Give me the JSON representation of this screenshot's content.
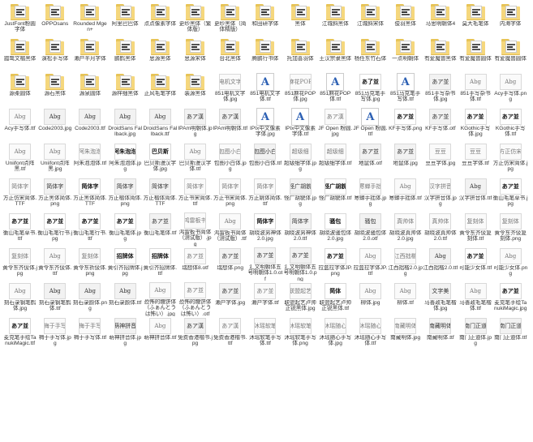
{
  "files": [
    {
      "name": "JustFont粉圆字体",
      "kind": "folder"
    },
    {
      "name": "OPPOsans",
      "kind": "folder"
    },
    {
      "name": "Rounded Mgen+",
      "kind": "folder"
    },
    {
      "name": "阿里巴巴体",
      "kind": "folder"
    },
    {
      "name": "点点像素字体",
      "kind": "folder"
    },
    {
      "name": "更纱黑体（繁体版）",
      "kind": "folder"
    },
    {
      "name": "更纱黑体（简体精版）",
      "kind": "folder"
    },
    {
      "name": "和田研字体",
      "kind": "folder"
    },
    {
      "name": "黑体",
      "kind": "folder"
    },
    {
      "name": "江城斜黑体",
      "kind": "folder"
    },
    {
      "name": "江城斜宋体",
      "kind": "folder"
    },
    {
      "name": "俊羽黑体",
      "kind": "folder"
    },
    {
      "name": "马思明朝体4",
      "kind": "folder"
    },
    {
      "name": "莫大毛笔体",
      "kind": "folder"
    },
    {
      "name": "内海字体",
      "kind": "folder"
    },
    {
      "name": "霞鹜文楷黑体",
      "kind": "folder"
    },
    {
      "name": "演松手写体",
      "kind": "folder"
    },
    {
      "name": "濑户半月字体",
      "kind": "folder"
    },
    {
      "name": "鹏鹤黑体",
      "kind": "folder"
    },
    {
      "name": "思源黑体",
      "kind": "folder"
    },
    {
      "name": "思源宋体",
      "kind": "folder"
    },
    {
      "name": "台北黑体",
      "kind": "folder"
    },
    {
      "name": "腾鹏行书体",
      "kind": "folder"
    },
    {
      "name": "托加喜羽体",
      "kind": "folder"
    },
    {
      "name": "王汉宗隶黑体",
      "kind": "folder"
    },
    {
      "name": "杨任东竹石体",
      "kind": "folder"
    },
    {
      "name": "一点明朝体",
      "kind": "folder"
    },
    {
      "name": "有爱魔兽黑体",
      "kind": "folder"
    },
    {
      "name": "有爱魔兽圆体",
      "kind": "folder"
    },
    {
      "name": "有爱魔兽圆体",
      "kind": "folder"
    },
    {
      "name": "源柔圆体",
      "kind": "folder"
    },
    {
      "name": "源石黑体",
      "kind": "folder"
    },
    {
      "name": "源泉圆体",
      "kind": "folder"
    },
    {
      "name": "源样细黑体",
      "kind": "folder"
    },
    {
      "name": "正风毛笔字体",
      "kind": "folder"
    },
    {
      "name": "装源黑体",
      "kind": "folder"
    },
    {
      "name": "851电机文字体.jpg",
      "kind": "image",
      "sample": "电机文字",
      "style": "light"
    },
    {
      "name": "851电机文字体.ttf",
      "kind": "font"
    },
    {
      "name": "851麻花POP体.jpg",
      "kind": "image",
      "sample": "麻花POP",
      "style": "light"
    },
    {
      "name": "851麻花POP体.ttf",
      "kind": "font"
    },
    {
      "name": "851马克笔手写体.jpg",
      "kind": "image",
      "sample": "あ了並",
      "style": "dark"
    },
    {
      "name": "851马克笔手写体.ttf",
      "kind": "font"
    },
    {
      "name": "851手写杂书体.jpg",
      "kind": "image",
      "sample": "あア並",
      "style": "normal"
    },
    {
      "name": "851手写杂书体.ttf",
      "kind": "image",
      "sample": "Abg",
      "style": "light"
    },
    {
      "name": "Acy手写体.png",
      "kind": "image",
      "sample": "Abg",
      "style": "light"
    },
    {
      "name": "Acy手写体.ttf",
      "kind": "image",
      "sample": "Abg",
      "style": "light"
    },
    {
      "name": "Code2003.jpg",
      "kind": "image",
      "sample": "Abg",
      "style": "normal"
    },
    {
      "name": "Code2003.ttf",
      "kind": "image",
      "sample": "Abg",
      "style": "normal"
    },
    {
      "name": "DroidSans Fallback.jpg",
      "kind": "image",
      "sample": "Abg",
      "style": "normal"
    },
    {
      "name": "DroidSans Fallback.ttf",
      "kind": "image",
      "sample": "Abg",
      "style": "normal"
    },
    {
      "name": "IPAm明朝体.jpg",
      "kind": "image",
      "sample": "あア漢",
      "style": "normal"
    },
    {
      "name": "IPAm明朝体.ttf",
      "kind": "image",
      "sample": "あア漢",
      "style": "normal"
    },
    {
      "name": "IPIx中文像素字体.jpg",
      "kind": "font"
    },
    {
      "name": "IPIx中文像素字体.ttf",
      "kind": "font"
    },
    {
      "name": "JF Open 粉圆.jpg",
      "kind": "image",
      "sample": "あア漢",
      "style": "light"
    },
    {
      "name": "JF Open 粉圆.ttf",
      "kind": "font"
    },
    {
      "name": "KF手写体.png",
      "kind": "image",
      "sample": "あア並",
      "style": "dark"
    },
    {
      "name": "KF手写体.otf",
      "kind": "image",
      "sample": "あア並",
      "style": "normal"
    },
    {
      "name": "KGothic手写体.jpg",
      "kind": "image",
      "sample": "あア並",
      "style": "dark"
    },
    {
      "name": "KGothic手写体.ttf",
      "kind": "image",
      "sample": "あア並",
      "style": "dark"
    },
    {
      "name": "Uniifont点阵黑.ttf",
      "kind": "image",
      "sample": "Abg",
      "style": "light"
    },
    {
      "name": "Uniifont点阵黑.jpg",
      "kind": "image",
      "sample": "Abg",
      "style": "light"
    },
    {
      "name": "阿朱泡泡体.ttf",
      "kind": "image",
      "sample": "阿朱泡泡",
      "style": "light"
    },
    {
      "name": "阿朱泡泡体.jpg",
      "kind": "image",
      "sample": "阿朱泡泡",
      "style": "dark"
    },
    {
      "name": "巴贝斯漫汉字体.jpg",
      "kind": "image",
      "sample": "巴贝斯",
      "style": "dark"
    },
    {
      "name": "巴贝斯漫汉字体.ttf",
      "kind": "image",
      "sample": "Abg",
      "style": "light"
    },
    {
      "name": "包图小白体.jpg",
      "kind": "image",
      "sample": "包图小白",
      "style": "light"
    },
    {
      "name": "包图小白体.ttf",
      "kind": "image",
      "sample": "包图小白",
      "style": "normal"
    },
    {
      "name": "超级细字体.jpg",
      "kind": "image",
      "sample": "超级细",
      "style": "light"
    },
    {
      "name": "超级细字体.ttf",
      "kind": "image",
      "sample": "超级细",
      "style": "light"
    },
    {
      "name": "地鼠体.otf",
      "kind": "image",
      "sample": "あア並",
      "style": "normal"
    },
    {
      "name": "地鼠体.jpg",
      "kind": "image",
      "sample": "あア並",
      "style": "normal"
    },
    {
      "name": "豆豆字体.jpg",
      "kind": "image",
      "sample": "豆豆",
      "style": "light"
    },
    {
      "name": "豆豆字体.ttf",
      "kind": "image",
      "sample": "豆豆",
      "style": "light"
    },
    {
      "name": "方正仿宋简体.jpg",
      "kind": "image",
      "sample": "方正仿宋",
      "style": "light"
    },
    {
      "name": "方正仿宋简体.TTF",
      "kind": "image",
      "sample": "简体字",
      "style": "light"
    },
    {
      "name": "方正黑体简体.png",
      "kind": "image",
      "sample": "简体字",
      "style": "normal"
    },
    {
      "name": "方正黑体简体.TTF",
      "kind": "image",
      "sample": "简体字",
      "style": "dark"
    },
    {
      "name": "方正楷体简体.png",
      "kind": "image",
      "sample": "简体字",
      "style": "normal"
    },
    {
      "name": "方正楷体简体.TTF",
      "kind": "image",
      "sample": "简体字",
      "style": "normal"
    },
    {
      "name": "方正书宋简体.ttf",
      "kind": "image",
      "sample": "简体字",
      "style": "light"
    },
    {
      "name": "方正书宋简体.png",
      "kind": "image",
      "sample": "简体字",
      "style": "light"
    },
    {
      "name": "方正姚体简体.ttf",
      "kind": "image",
      "sample": "简体字",
      "style": "light"
    },
    {
      "name": "怪广胡貌体.jpg",
      "kind": "image",
      "sample": "怪广胡貌",
      "style": "normal"
    },
    {
      "name": "怪广胡貌体.ttf",
      "kind": "image",
      "sample": "怪广胡貌",
      "style": "dark"
    },
    {
      "name": "寒蝉手拙体.jpg",
      "kind": "image",
      "sample": "寒蝉手拙",
      "style": "light"
    },
    {
      "name": "寒蝉手拙体.ttf",
      "kind": "image",
      "sample": "Abg",
      "style": "light"
    },
    {
      "name": "汉字拼音体.jpg",
      "kind": "image",
      "sample": "汉字拼音",
      "style": "light"
    },
    {
      "name": "汉字拼音体.ttf",
      "kind": "image",
      "sample": "Abg",
      "style": "normal"
    },
    {
      "name": "衡山毛笔草书.jpg",
      "kind": "image",
      "sample": "あア並",
      "style": "dark"
    },
    {
      "name": "衡山毛笔草书.ttf",
      "kind": "image",
      "sample": "あア並",
      "style": "dark"
    },
    {
      "name": "衡山毛笔行书.jpg",
      "kind": "image",
      "sample": "あア並",
      "style": "dark"
    },
    {
      "name": "衡山毛笔行书.ttf",
      "kind": "image",
      "sample": "あア並",
      "style": "dark"
    },
    {
      "name": "衡山毛笔体.jpg",
      "kind": "image",
      "sample": "あア並",
      "style": "dark"
    },
    {
      "name": "衡山毛笔体.ttf",
      "kind": "image",
      "sample": "あア並",
      "style": "normal"
    },
    {
      "name": "鸿雷板书简体（测试版）.jpg",
      "kind": "image",
      "sample": "鸿雷板书",
      "style": "light"
    },
    {
      "name": "鸿雷板书简体（测试版）.ttf",
      "kind": "image",
      "sample": "Abg",
      "style": "light"
    },
    {
      "name": "胡晓波男神体2.0.jpg",
      "kind": "image",
      "sample": "简体字",
      "style": "dark"
    },
    {
      "name": "胡晓波男神体2.0.ttf",
      "kind": "image",
      "sample": "简体字",
      "style": "normal"
    },
    {
      "name": "胡晓波骚包体2.0.jpg",
      "kind": "image",
      "sample": "骚包",
      "style": "dark"
    },
    {
      "name": "胡晓波骚包体2.0.otf",
      "kind": "image",
      "sample": "骚包",
      "style": "normal"
    },
    {
      "name": "胡晓波真帅体2.0.jpg",
      "kind": "image",
      "sample": "真帅体",
      "style": "light"
    },
    {
      "name": "胡晓波真帅体2.0.ttf",
      "kind": "image",
      "sample": "真帅体",
      "style": "light"
    },
    {
      "name": "黄令东齐伋复刻体.ttf",
      "kind": "image",
      "sample": "复刻体",
      "style": "light"
    },
    {
      "name": "黄令东齐伋复刻体.png",
      "kind": "image",
      "sample": "复刻体",
      "style": "light"
    },
    {
      "name": "黄令东齐伋体.jpg",
      "kind": "image",
      "sample": "复刻体",
      "style": "light"
    },
    {
      "name": "黄令东齐伋体.ttf",
      "kind": "image",
      "sample": "Abg",
      "style": "light"
    },
    {
      "name": "黄令东祈伋体.png",
      "kind": "image",
      "sample": "复刻体",
      "style": "light"
    },
    {
      "name": "黄引齐招牌体.jpg",
      "kind": "image",
      "sample": "招牌体",
      "style": "dark"
    },
    {
      "name": "黄引齐招牌体.ttf",
      "kind": "image",
      "sample": "招牌体",
      "style": "dark"
    },
    {
      "name": "瑞想体8.otf",
      "kind": "image",
      "sample": "あア並",
      "style": "light"
    },
    {
      "name": "瑞想体.png",
      "kind": "image",
      "sample": "あア並",
      "style": "normal"
    },
    {
      "name": "汇文明朝体五号明朝体1.0.otf",
      "kind": "image",
      "sample": "あア並",
      "style": "normal"
    },
    {
      "name": "汇文明朝体五号明朝体1.0.png",
      "kind": "image",
      "sample": "あア並",
      "style": "normal"
    },
    {
      "name": "拉盒拉字体JP.png",
      "kind": "image",
      "sample": "あア並",
      "style": "dark"
    },
    {
      "name": "拉盒拉字体JP.ttf",
      "kind": "image",
      "sample": "Abg",
      "style": "light"
    },
    {
      "name": "江西拙楷2.0.jpg",
      "kind": "image",
      "sample": "江西拙楷",
      "style": "light"
    },
    {
      "name": "江西拙楷2.0.ttf",
      "kind": "image",
      "sample": "Abg",
      "style": "normal"
    },
    {
      "name": "可能少女体.ttf",
      "kind": "image",
      "sample": "あア並",
      "style": "dark"
    },
    {
      "name": "可能少女体.png",
      "kind": "image",
      "sample": "Abg",
      "style": "light"
    },
    {
      "name": "刻石录钢笔鹤体.jpg",
      "kind": "image",
      "sample": "Abg",
      "style": "light"
    },
    {
      "name": "刻石录钢笔鹤体.ttf",
      "kind": "image",
      "sample": "Abg",
      "style": "normal"
    },
    {
      "name": "刻石录颜体.png",
      "kind": "image",
      "sample": "Abg",
      "style": "normal"
    },
    {
      "name": "刻石录颜体.ttf",
      "kind": "image",
      "sample": "Abg",
      "style": "normal"
    },
    {
      "name": "恐怖的糖饼体（ふぁんとうは怖い）.jpg",
      "kind": "image",
      "sample": "Abg",
      "style": "light"
    },
    {
      "name": "恐怖的糖饼体（ふぁんとうは怖い）.otf",
      "kind": "image",
      "sample": "あア並",
      "style": "light"
    },
    {
      "name": "濑户字体.jpg",
      "kind": "image",
      "sample": "あア並",
      "style": "normal"
    },
    {
      "name": "濑户字体.ttf",
      "kind": "image",
      "sample": "あア並",
      "style": "light"
    },
    {
      "name": "联盟起艺卢帅正锐黑体.jpg",
      "kind": "image",
      "sample": "联盟起艺",
      "style": "light"
    },
    {
      "name": "联盟起艺卢帅正锐黑体.ttf",
      "kind": "image",
      "sample": "简体",
      "style": "dark"
    },
    {
      "name": "柳体.jpg",
      "kind": "image",
      "sample": "Abg",
      "style": "light"
    },
    {
      "name": "柳体.ttf",
      "kind": "image",
      "sample": "Abg",
      "style": "light"
    },
    {
      "name": "马善政毛笔楷体.jpg",
      "kind": "image",
      "sample": "文字美",
      "style": "normal"
    },
    {
      "name": "马善政毛笔楷体.ttf",
      "kind": "image",
      "sample": "Abg",
      "style": "light"
    },
    {
      "name": "麦克笔手绘TanukiMagic.jpg",
      "kind": "image",
      "sample": "あア並",
      "style": "dark"
    },
    {
      "name": "麦克笔手绘TanukiMagic.ttf",
      "kind": "image",
      "sample": "あア並",
      "style": "dark"
    },
    {
      "name": "梅于手写体.jpg",
      "kind": "image",
      "sample": "梅于手写",
      "style": "light"
    },
    {
      "name": "梅于手写体.ttf",
      "kind": "image",
      "sample": "梅于手写",
      "style": "light"
    },
    {
      "name": "萌神拼音体.jpg",
      "kind": "image",
      "sample": "萌神拼音",
      "style": "normal"
    },
    {
      "name": "萌神拼音体.ttf",
      "kind": "image",
      "sample": "Abg",
      "style": "light"
    },
    {
      "name": "免费香港楷书.jpg",
      "kind": "image",
      "sample": "あア漢",
      "style": "normal"
    },
    {
      "name": "免费香港楷书.ttf",
      "kind": "image",
      "sample": "あア漢",
      "style": "light"
    },
    {
      "name": "沐瑶软笔手写体.ttf",
      "kind": "image",
      "sample": "沐瑶软笔",
      "style": "light"
    },
    {
      "name": "沐瑶软笔手写体.png",
      "kind": "image",
      "sample": "沐瑶软笔",
      "style": "light"
    },
    {
      "name": "沐瑶随心手写体.jpg",
      "kind": "image",
      "sample": "沐瑶随心",
      "style": "light"
    },
    {
      "name": "沐瑶随心手写体.ttf",
      "kind": "image",
      "sample": "沐瑶随心",
      "style": "light"
    },
    {
      "name": "南藏明体.jpg",
      "kind": "image",
      "sample": "南藏明体",
      "style": "light"
    },
    {
      "name": "南藏明体.ttf",
      "kind": "image",
      "sample": "南藏明体",
      "style": "normal"
    },
    {
      "name": "南门正道体.jpg",
      "kind": "image",
      "sample": "南门正道",
      "style": "normal"
    },
    {
      "name": "南门正道体.ttf",
      "kind": "image",
      "sample": "南门正道",
      "style": "normal"
    }
  ]
}
